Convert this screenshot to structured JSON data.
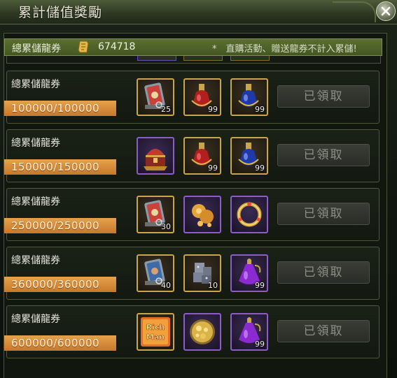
{
  "window": {
    "title": "累計儲值獎勵"
  },
  "summary": {
    "label": "總累儲龍券",
    "value": "674718",
    "note": "*　直購活動、贈送龍券不計入累儲!"
  },
  "rows": [
    {
      "title": "總累儲龍券",
      "progress": "100000/100000",
      "button": "已領取",
      "items": [
        {
          "icon": "dragon-ticket-card-icon",
          "qty": "25"
        },
        {
          "icon": "red-potion-icon",
          "qty": "99"
        },
        {
          "icon": "blue-potion-icon",
          "qty": "99"
        }
      ]
    },
    {
      "title": "總累儲龍券",
      "progress": "150000/150000",
      "button": "已領取",
      "items": [
        {
          "icon": "treasure-chest-icon",
          "qty": ""
        },
        {
          "icon": "red-potion-icon",
          "qty": "99"
        },
        {
          "icon": "blue-potion-icon",
          "qty": "99"
        }
      ]
    },
    {
      "title": "總累儲龍券",
      "progress": "250000/250000",
      "button": "已領取",
      "items": [
        {
          "icon": "dragon-ticket-card-icon",
          "qty": "30"
        },
        {
          "icon": "gold-pouch-icon",
          "qty": ""
        },
        {
          "icon": "gold-ring-icon",
          "qty": ""
        }
      ]
    },
    {
      "title": "總累儲龍券",
      "progress": "360000/360000",
      "button": "已領取",
      "items": [
        {
          "icon": "ticket-card-blue-icon",
          "qty": "40"
        },
        {
          "icon": "gray-cube-icon",
          "qty": "10"
        },
        {
          "icon": "purple-potion-icon",
          "qty": "99"
        }
      ]
    },
    {
      "title": "總累儲龍券",
      "progress": "600000/600000",
      "button": "已領取",
      "items": [
        {
          "icon": "rich-man-card-icon",
          "qty": "",
          "text": "Rich Man"
        },
        {
          "icon": "gold-coins-orb-icon",
          "qty": ""
        },
        {
          "icon": "purple-potion-icon",
          "qty": "99"
        }
      ]
    }
  ]
}
